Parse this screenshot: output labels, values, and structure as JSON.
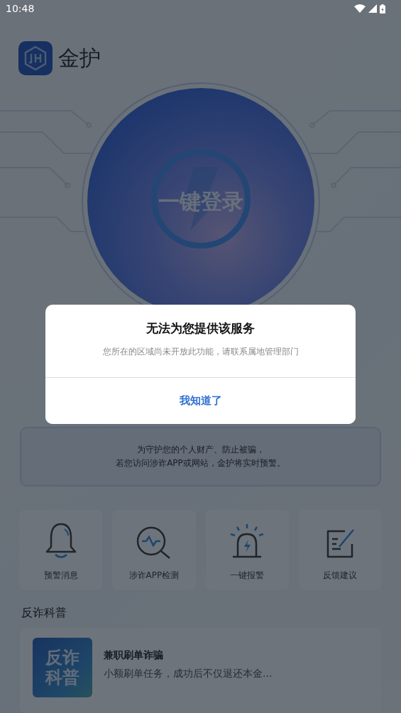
{
  "status_bar": {
    "time": "10:48"
  },
  "app": {
    "name": "金护"
  },
  "login_button": {
    "label": "一键登录"
  },
  "notice": {
    "lines": [
      "为守护您的个人财产、防止被骗，",
      "若您访问涉诈APP或网站，金护将实时预警。"
    ]
  },
  "features": [
    {
      "label": "预警消息",
      "kind": "bell"
    },
    {
      "label": "涉诈APP检测",
      "kind": "scan"
    },
    {
      "label": "一键报警",
      "kind": "siren"
    },
    {
      "label": "反馈建议",
      "kind": "edit"
    }
  ],
  "section": {
    "title": "反诈科普"
  },
  "articles": [
    {
      "thumbnail_lines": [
        "反诈",
        "科普"
      ],
      "title": "兼职刷单诈骗",
      "summary": "小额刷单任务，成功后不仅退还本金..."
    }
  ],
  "dialog": {
    "title": "无法为您提供该服务",
    "message": "您所在的区域尚未开放此功能，请联系属地管理部门",
    "button": "我知道了"
  }
}
